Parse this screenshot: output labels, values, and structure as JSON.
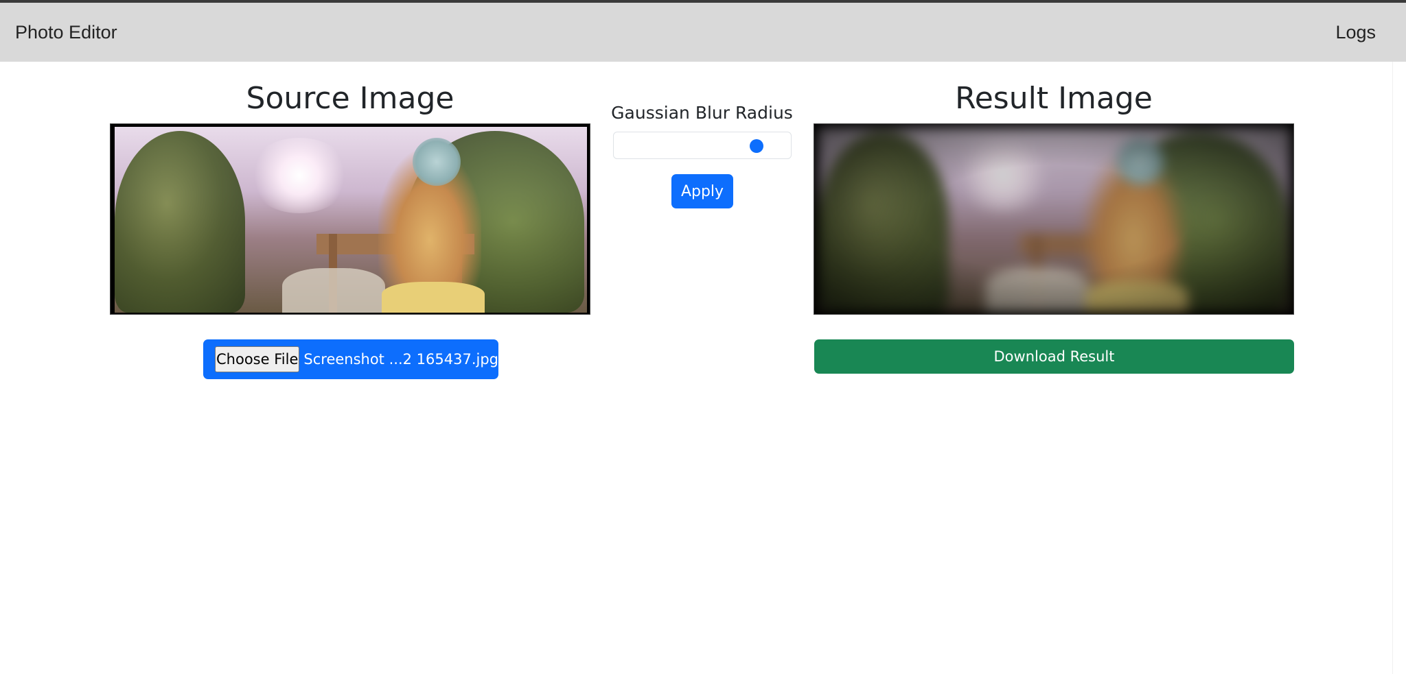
{
  "navbar": {
    "brand": "Photo Editor",
    "logs_link": "Logs"
  },
  "source": {
    "title": "Source Image",
    "choose_file_label": "Choose File",
    "file_name": "Screenshot ...2 165437.jpg"
  },
  "controls": {
    "blur_label": "Gaussian Blur Radius",
    "blur_value_fraction": 0.83,
    "apply_label": "Apply"
  },
  "result": {
    "title": "Result Image",
    "download_label": "Download Result"
  },
  "colors": {
    "primary": "#0d6efd",
    "success": "#198754",
    "navbar_bg": "#d9d9d9"
  }
}
